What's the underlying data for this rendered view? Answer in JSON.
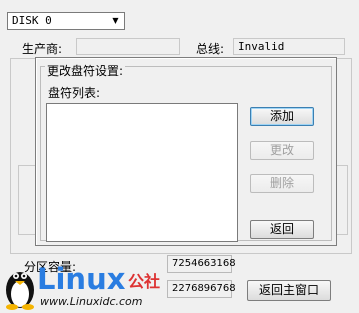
{
  "disk_select": {
    "value": "DISK 0"
  },
  "labels": {
    "manufacturer": "生产商:",
    "bus": "总线:",
    "bus_value": "Invalid",
    "partition_capacity": "分区容量:",
    "capacity_value_1": "7254663168",
    "capacity_value_2": "2276896768"
  },
  "dialog": {
    "title": "更改盘符设置:",
    "list_label": "盘符列表:",
    "buttons": {
      "add": "添加",
      "change": "更改",
      "delete": "删除",
      "back": "返回"
    }
  },
  "main_buttons": {
    "back_main": "返回主窗口"
  },
  "watermark": {
    "brand": "Linux",
    "cn": "公社",
    "url": "www.Linuxidc.com"
  }
}
